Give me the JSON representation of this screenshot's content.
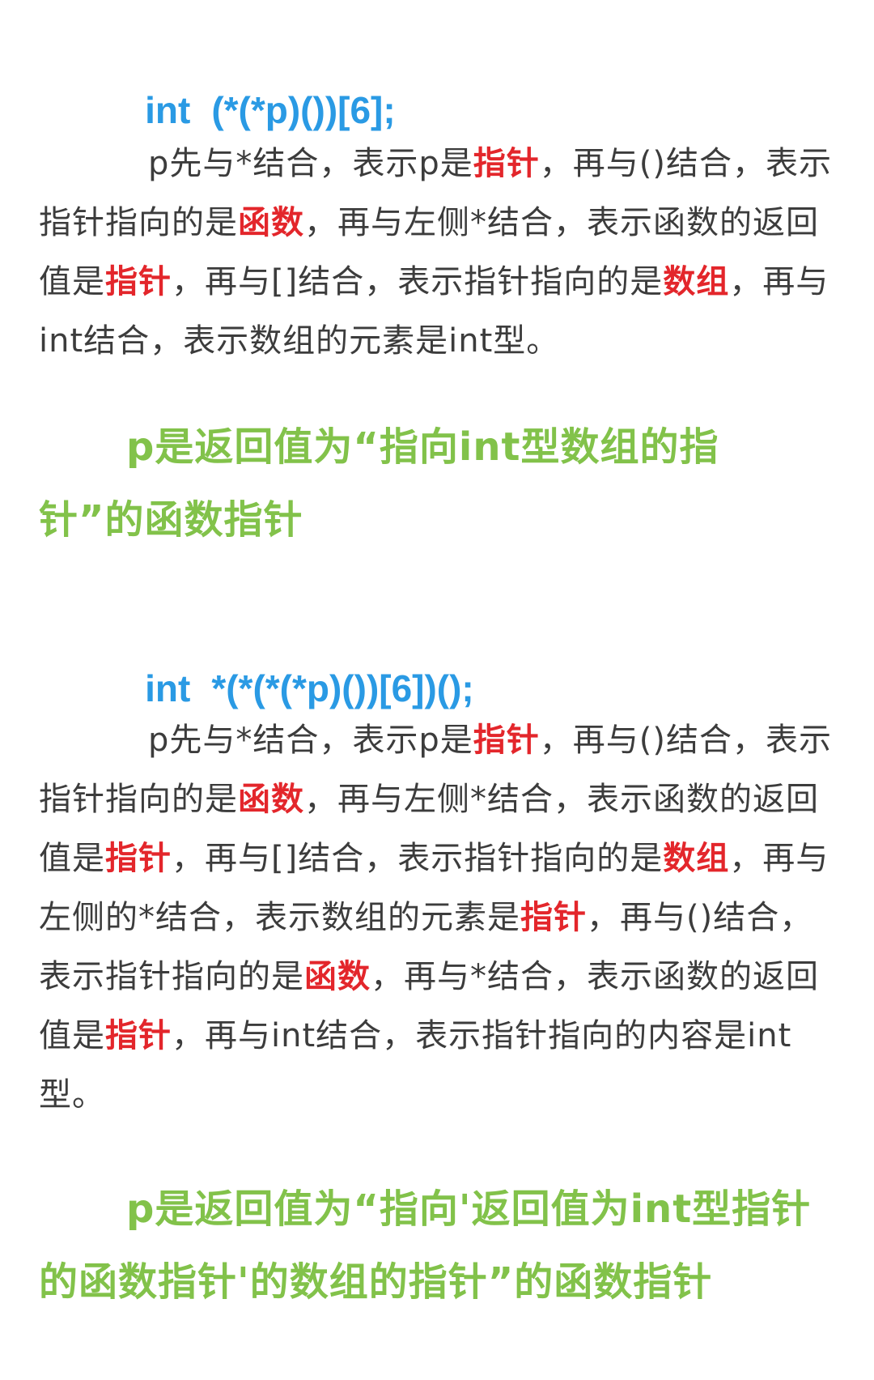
{
  "sections": [
    {
      "code_type": "int",
      "code_decl": "(*(*p)())[6];",
      "explanation": [
        {
          "t": "p先与*结合，表示p是",
          "h": false
        },
        {
          "t": "指针",
          "h": true
        },
        {
          "t": "，再与()结合，表示指针指向的是",
          "h": false
        },
        {
          "t": "函数",
          "h": true
        },
        {
          "t": "，再与左侧*结合，表示函数的返回值是",
          "h": false
        },
        {
          "t": "指针",
          "h": true
        },
        {
          "t": "，再与[]结合，表示指针指向的是",
          "h": false
        },
        {
          "t": "数组",
          "h": true
        },
        {
          "t": "，再与int结合，表示数组的元素是int型。",
          "h": false
        }
      ],
      "summary": "p是返回值为“指向int型数组的指针”的函数指针"
    },
    {
      "code_type": "int",
      "code_decl": "*(*(*(*p)())[6])();",
      "explanation": [
        {
          "t": "p先与*结合，表示p是",
          "h": false
        },
        {
          "t": "指针",
          "h": true
        },
        {
          "t": "，再与()结合，表示指针指向的是",
          "h": false
        },
        {
          "t": "函数",
          "h": true
        },
        {
          "t": "，再与左侧*结合，表示函数的返回值是",
          "h": false
        },
        {
          "t": "指针",
          "h": true
        },
        {
          "t": "，再与[]结合，表示指针指向的是",
          "h": false
        },
        {
          "t": "数组",
          "h": true
        },
        {
          "t": "，再与左侧的*结合，表示数组的元素是",
          "h": false
        },
        {
          "t": "指针",
          "h": true
        },
        {
          "t": "，再与()结合，表示指针指向的是",
          "h": false
        },
        {
          "t": "函数",
          "h": true
        },
        {
          "t": "，再与*结合，表示函数的返回值是",
          "h": false
        },
        {
          "t": "指针",
          "h": true
        },
        {
          "t": "，再与int结合，表示指针指向的内容是int型。",
          "h": false
        }
      ],
      "summary": "p是返回值为“指向'返回值为int型指针的函数指针'的数组的指针”的函数指针"
    }
  ],
  "colors": {
    "code": "#2a9ae4",
    "text": "#3c3c3c",
    "highlight": "#e3262b",
    "summary": "#82c24a"
  }
}
